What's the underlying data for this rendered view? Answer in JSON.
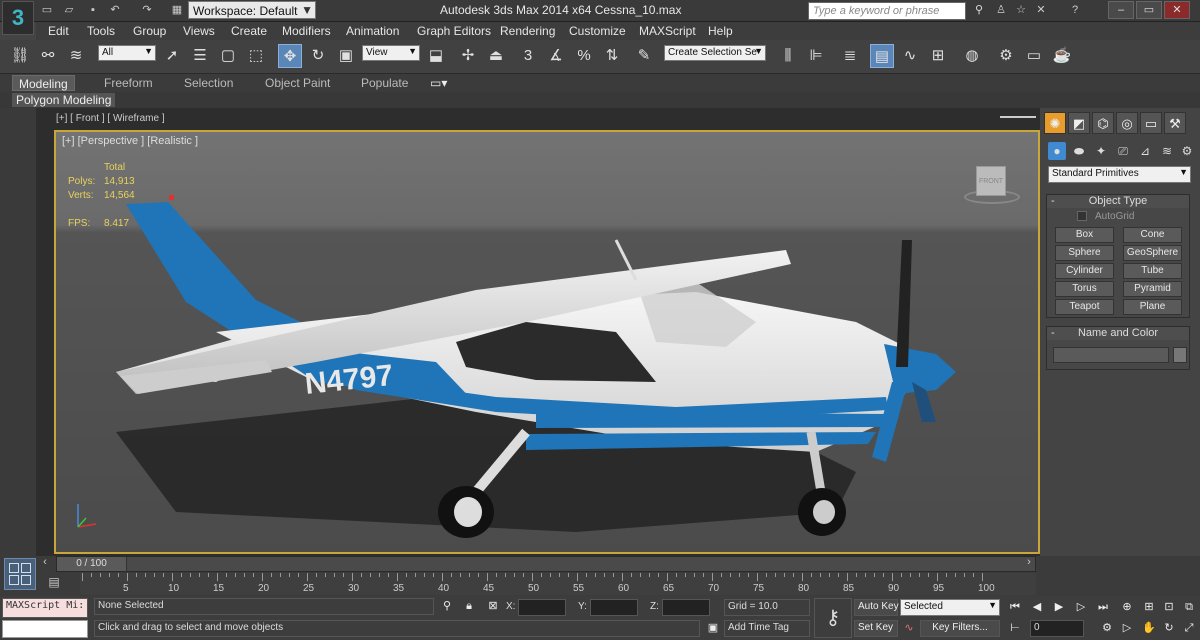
{
  "title_bar": {
    "workspace": "Workspace: Default",
    "app_title": "Autodesk 3ds Max  2014 x64     Cessna_10.max",
    "search_placeholder": "Type a keyword or phrase"
  },
  "menu": [
    "Edit",
    "Tools",
    "Group",
    "Views",
    "Create",
    "Modifiers",
    "Animation",
    "Graph Editors",
    "Rendering",
    "Customize",
    "MAXScript",
    "Help"
  ],
  "toolbar": {
    "selection_filter": "All",
    "ref_coord": "View",
    "named_selection": "Create Selection Se",
    "snap_label": "3"
  },
  "ribbon": {
    "tabs": [
      "Modeling",
      "Freeform",
      "Selection",
      "Object Paint",
      "Populate"
    ],
    "active": "Modeling",
    "panel": "Polygon Modeling"
  },
  "viewport": {
    "front_label": "[+] [ Front ] [ Wireframe ]",
    "label": "[+] [Perspective ] [Realistic ]",
    "stats": {
      "total_label": "Total",
      "polys_label": "Polys:",
      "polys": "14,913",
      "verts_label": "Verts:",
      "verts": "14,564",
      "fps_label": "FPS:",
      "fps": "8.417"
    },
    "viewcube_label": "FRONT",
    "tail_number": "N4797"
  },
  "command_panel": {
    "dropdown": "Standard Primitives",
    "object_type_title": "Object Type",
    "autogrid": "AutoGrid",
    "buttons": [
      "Box",
      "Cone",
      "Sphere",
      "GeoSphere",
      "Cylinder",
      "Tube",
      "Torus",
      "Pyramid",
      "Teapot",
      "Plane"
    ],
    "name_color_title": "Name and Color"
  },
  "timeline": {
    "frame": "0 / 100",
    "ticks": [
      "5",
      "10",
      "15",
      "20",
      "25",
      "30",
      "35",
      "40",
      "45",
      "50",
      "55",
      "60",
      "65",
      "70",
      "75",
      "80",
      "85",
      "90",
      "95",
      "100"
    ]
  },
  "status": {
    "maxscript": "MAXScript Mi:",
    "selection": "None Selected",
    "prompt": "Click and drag to select and move objects",
    "x_label": "X:",
    "y_label": "Y:",
    "z_label": "Z:",
    "grid": "Grid = 10.0",
    "add_time_tag": "Add Time Tag",
    "auto_key": "Auto Key",
    "set_key": "Set Key",
    "key_mode": "Selected",
    "key_filters": "Key Filters...",
    "frame_value": "0"
  },
  "colors": {
    "accent": "#3f8ad1",
    "active_viewport_border": "#c9a63a",
    "stats_text": "#e8d25a",
    "plane_blue": "#1f75b8"
  }
}
